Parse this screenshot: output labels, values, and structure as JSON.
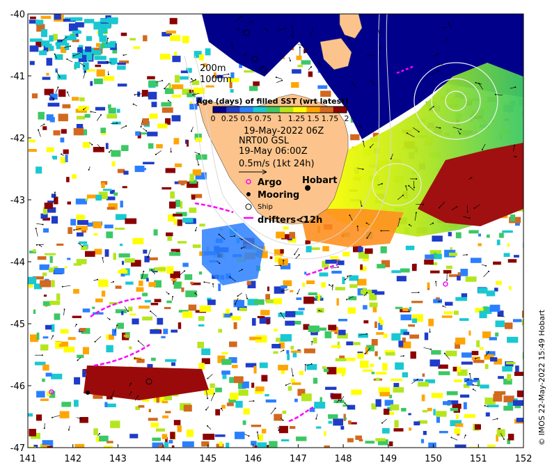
{
  "map": {
    "lon_ticks": [
      "141",
      "142",
      "143",
      "144",
      "145",
      "146",
      "147",
      "148",
      "149",
      "150",
      "151",
      "152"
    ],
    "lat_ticks": [
      "-40",
      "-41",
      "-42",
      "-43",
      "-44",
      "-45",
      "-46",
      "-47"
    ],
    "lon_range": [
      141,
      152
    ],
    "lat_range": [
      -47,
      -40
    ],
    "colorbar": {
      "title": "Age (days) of filled SST (wrt latest)",
      "tick_labels": [
        "0",
        "0.25",
        "0.5",
        "0.75",
        "1",
        "1.25",
        "1.5",
        "1.75",
        "2"
      ],
      "colors": [
        "#00008b",
        "#1e3cc8",
        "#2a7fff",
        "#19c8d2",
        "#3cc864",
        "#b4e61e",
        "#ffff00",
        "#ffa500",
        "#d2691e",
        "#8b0000"
      ]
    },
    "depth_labels": [
      "200m",
      "1000m"
    ],
    "annotations": {
      "date": "19-May-2022 06Z",
      "product": "NRT00 GSL",
      "time": "19-May 06:00Z",
      "vector_scale": "0.5m/s (1kt 24h)"
    },
    "legend": {
      "argo": "Argo",
      "mooring": "Mooring",
      "ship": "Ship",
      "drifters": "drifters<12h"
    },
    "place_label": "Hobart",
    "credit": "© IMOS 22-May-2022 15:49 Hobart",
    "colors": {
      "land": "#fcc48c",
      "deep_blue": "#00008b",
      "argo": "#ff00ff",
      "drifter": "#ff00ff"
    }
  }
}
